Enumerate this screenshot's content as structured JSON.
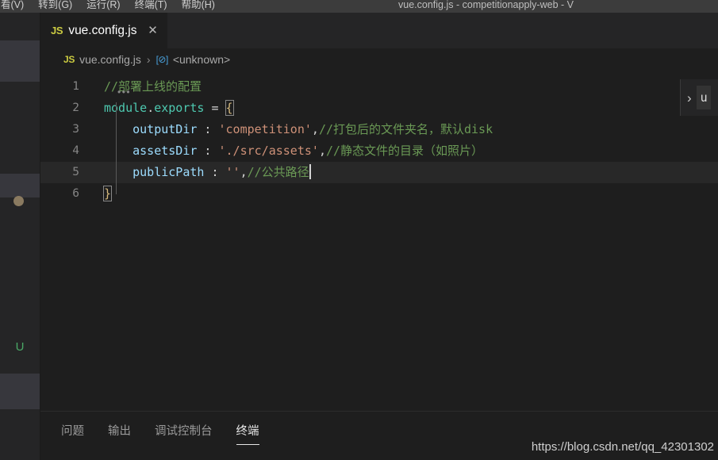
{
  "window": {
    "title": "vue.config.js - competitionapply-web - V",
    "menu": [
      {
        "label": "看(V)"
      },
      {
        "label": "转到(G)"
      },
      {
        "label": "运行(R)"
      },
      {
        "label": "终端(T)"
      },
      {
        "label": "帮助(H)"
      }
    ]
  },
  "sidebar": {
    "git_status_letter": "U"
  },
  "tab": {
    "badge": "JS",
    "label": "vue.config.js",
    "close": "✕"
  },
  "breadcrumb": {
    "badge": "JS",
    "file": "vue.config.js",
    "separator": "›",
    "module_icon": "[⊘]",
    "symbol": "<unknown>"
  },
  "editor": {
    "lines": [
      {
        "num": "1",
        "indent": "",
        "tokens": [
          {
            "t": "comment",
            "v": "//部署上线的配置"
          }
        ]
      },
      {
        "num": "2",
        "indent": "",
        "tokens": [
          {
            "t": "obj",
            "v": "module"
          },
          {
            "t": "punc",
            "v": "."
          },
          {
            "t": "obj",
            "v": "exports"
          },
          {
            "t": "op",
            "v": " = "
          },
          {
            "t": "brace-box",
            "v": "{"
          }
        ]
      },
      {
        "num": "3",
        "indent": "    ",
        "tokens": [
          {
            "t": "prop",
            "v": "outputDir"
          },
          {
            "t": "punc",
            "v": " : "
          },
          {
            "t": "str",
            "v": "'competition'"
          },
          {
            "t": "punc",
            "v": ","
          },
          {
            "t": "comment",
            "v": "//打包后的文件夹名，默认disk"
          }
        ]
      },
      {
        "num": "4",
        "indent": "    ",
        "tokens": [
          {
            "t": "prop",
            "v": "assetsDir"
          },
          {
            "t": "punc",
            "v": " : "
          },
          {
            "t": "str",
            "v": "'./src/assets'"
          },
          {
            "t": "punc",
            "v": ","
          },
          {
            "t": "comment",
            "v": "//静态文件的目录（如照片）"
          }
        ]
      },
      {
        "num": "5",
        "indent": "    ",
        "active": true,
        "caret": true,
        "tokens": [
          {
            "t": "prop",
            "v": "publicPath"
          },
          {
            "t": "punc",
            "v": " : "
          },
          {
            "t": "str",
            "v": "''"
          },
          {
            "t": "punc",
            "v": ","
          },
          {
            "t": "comment",
            "v": "//公共路径"
          }
        ]
      },
      {
        "num": "6",
        "indent": "",
        "tokens": [
          {
            "t": "brace-box",
            "v": "}"
          }
        ]
      }
    ],
    "fold_dots": "•••"
  },
  "side_widget": {
    "chevron": "›",
    "text": "u"
  },
  "panel": {
    "tabs": [
      {
        "label": "问题",
        "active": false
      },
      {
        "label": "输出",
        "active": false
      },
      {
        "label": "调试控制台",
        "active": false
      },
      {
        "label": "终端",
        "active": true
      }
    ]
  },
  "watermark": {
    "url": "https://blog.csdn.net/qq_42301302"
  },
  "colors": {
    "editor_bg": "#1e1e1e",
    "chrome_bg": "#252526",
    "titlebar_bg": "#3c3c3c",
    "comment": "#6a9955",
    "string": "#ce9178",
    "property": "#9cdcfe",
    "object": "#4ec9b0",
    "brace": "#d7ba7d",
    "git_untracked": "#4aa866",
    "modified_dot": "#8a7a60"
  }
}
